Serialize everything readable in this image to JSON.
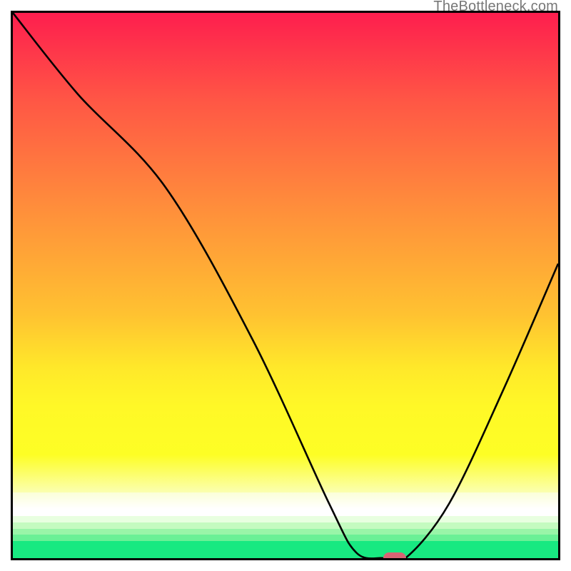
{
  "watermark": "TheBottleneck.com",
  "chart_data": {
    "type": "line",
    "title": "",
    "xlabel": "",
    "ylabel": "",
    "xlim": [
      0,
      100
    ],
    "ylim": [
      0,
      100
    ],
    "grid": false,
    "series": [
      {
        "name": "bottleneck-curve",
        "x": [
          0,
          12,
          28,
          44,
          58,
          63,
          68,
          72,
          80,
          90,
          100
        ],
        "y": [
          100,
          85,
          68,
          40,
          10,
          1,
          0,
          0,
          10,
          31,
          54
        ]
      }
    ],
    "marker": {
      "x": 70,
      "y": 0,
      "color": "#d96474"
    },
    "background_gradient": {
      "bands": [
        {
          "top_pct": 0.0,
          "height_pct": 65.0,
          "css": "linear-gradient(to bottom, #fe1e4e 0%, #ff5745 25%, #ff8e3b 55%, #ffc231 85%, #ffe82a 100%)"
        },
        {
          "top_pct": 65.0,
          "height_pct": 16.0,
          "css": "linear-gradient(to bottom, #ffe82a 0%, #fff827 45%, #fdfe25 100%)"
        },
        {
          "top_pct": 81.0,
          "height_pct": 7.0,
          "css": "linear-gradient(to bottom, #fdfe25 0%, #fbffb0 100%)"
        },
        {
          "top_pct": 88.0,
          "height_pct": 3.0,
          "css": "linear-gradient(to bottom, #fbffd8 0%, #ffffff 100%)"
        },
        {
          "top_pct": 91.0,
          "height_pct": 1.3,
          "css": "#ffffff"
        },
        {
          "top_pct": 92.3,
          "height_pct": 1.2,
          "css": "#e8ffe0"
        },
        {
          "top_pct": 93.5,
          "height_pct": 1.1,
          "css": "#c4fbc0"
        },
        {
          "top_pct": 94.6,
          "height_pct": 1.1,
          "css": "#99f5a8"
        },
        {
          "top_pct": 95.7,
          "height_pct": 1.1,
          "css": "#6af096"
        },
        {
          "top_pct": 96.8,
          "height_pct": 3.2,
          "css": "#18e981"
        }
      ]
    }
  }
}
